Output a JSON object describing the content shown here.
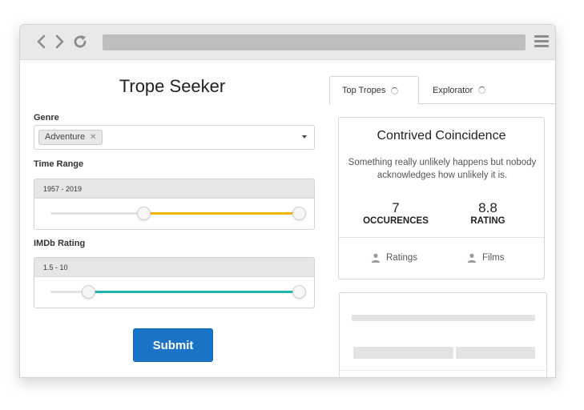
{
  "app": {
    "title": "Trope Seeker"
  },
  "form": {
    "genre_label": "Genre",
    "genre_selected": "Adventure",
    "genre_remove_glyph": "✕",
    "time_range_label": "Time Range",
    "time_range_value": "1957 - 2019",
    "time_range_fill": [
      0.375,
      1.0
    ],
    "time_range_color": "#f4b400",
    "imdb_label": "IMDb Rating",
    "imdb_value": "1.5 - 10",
    "imdb_fill": [
      0.15,
      1.0
    ],
    "imdb_color": "#1fb3ae",
    "submit_label": "Submit",
    "submit_color": "#1a73c6"
  },
  "tabs": [
    {
      "label": "Top Tropes",
      "active": true
    },
    {
      "label": "Explorator",
      "active": false
    }
  ],
  "card": {
    "title": "Contrived Coincidence",
    "description": "Something really unlikely happens but nobody acknowledges how unlikely it is.",
    "occurrences_value": "7",
    "occurrences_label": "OCCURENCES",
    "rating_value": "8.8",
    "rating_label": "RATING",
    "ratings_link": "Ratings",
    "films_link": "Films"
  }
}
